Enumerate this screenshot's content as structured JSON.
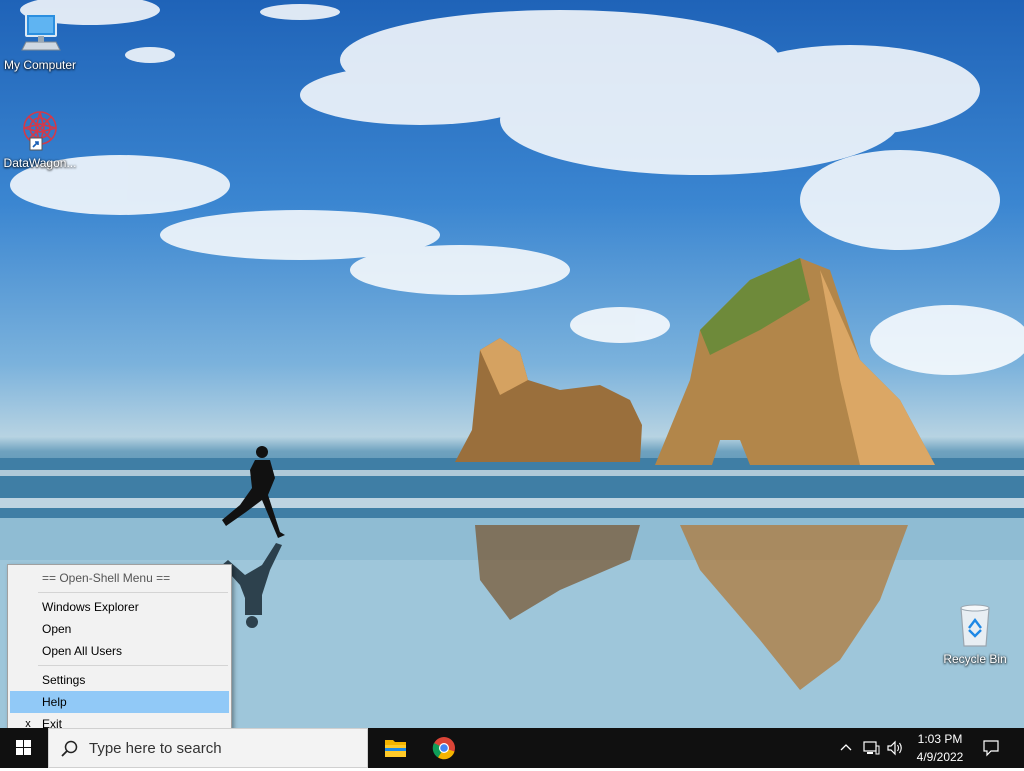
{
  "desktop": {
    "icons": [
      {
        "label": "My Computer",
        "icon": "monitor-icon"
      },
      {
        "label": "DataWagon...",
        "icon": "datawagon-icon"
      },
      {
        "label": "Recycle Bin",
        "icon": "recycle-bin-icon"
      }
    ]
  },
  "context_menu": {
    "header": "== Open-Shell Menu ==",
    "items": [
      {
        "label": "Windows Explorer"
      },
      {
        "label": "Open"
      },
      {
        "label": "Open All Users"
      },
      {
        "label": "Settings"
      },
      {
        "label": "Help",
        "highlighted": true
      },
      {
        "label": "Exit",
        "mark": "x"
      }
    ]
  },
  "taskbar": {
    "search_placeholder": "Type here to search",
    "pinned": [
      {
        "name": "File Explorer",
        "icon": "folder-icon"
      },
      {
        "name": "Google Chrome",
        "icon": "chrome-icon"
      }
    ],
    "tray": {
      "time": "1:03 PM",
      "date": "4/9/2022",
      "icons": [
        "chevron-up-icon",
        "network-icon",
        "volume-icon",
        "notification-icon"
      ]
    }
  },
  "colors": {
    "taskbar": "#101010",
    "menu_highlight": "#91c9f7",
    "menu_bg": "#f2f2f2"
  }
}
